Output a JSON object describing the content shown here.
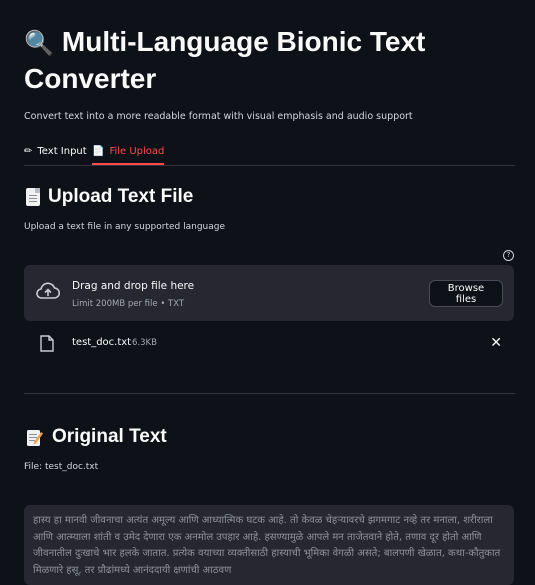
{
  "header": {
    "title_icon": "magnifier-icon",
    "title_glyph": "🔍",
    "title": "Multi-Language Bionic Text Converter",
    "subtitle": "Convert text into a more readable format with visual emphasis and audio support"
  },
  "tabs": [
    {
      "label": "Text Input",
      "icon": "pencil-icon",
      "glyph": "✏",
      "active": false
    },
    {
      "label": "File Upload",
      "icon": "document-icon",
      "glyph": "📄",
      "active": true
    }
  ],
  "upload": {
    "heading": "Upload Text File",
    "caption": "Upload a text file in any supported language",
    "help_glyph": "?",
    "dropzone_title": "Drag and drop file here",
    "dropzone_limit": "Limit 200MB per file • TXT",
    "browse_label": "Browse files",
    "file_name": "test_doc.txt",
    "file_size": "6.3KB",
    "remove_glyph": "✕"
  },
  "original": {
    "heading": "Original Text",
    "file_label": "File: test_doc.txt",
    "text": "हास्य हा मानवी जीवनाचा अत्यंत अमूल्य आणि आध्यात्मिक घटक आहे. तो केवळ चेहऱ्यावरचे झगमगाट नव्हे तर मनाला, शरीराला आणि आत्म्याला शांती व उमेद देणारा एक अनमोल उपहार आहे. हसण्यामुळे आपले मन ताजेतवाने होते, तणाव दूर होतो आणि जीवनातील दुःखाचे भार हलके जातात. प्रत्येक वयाच्या व्यक्तीसाठी हास्याची भूमिका वेगळी असते; बालपणी खेळात, कथा-कौतुकात मिळणारे हसू, तर प्रौढांमध्ये आनंददायी क्षणांची आठवण"
  },
  "colors": {
    "background": "#0e1117",
    "accent": "#ff4b4b",
    "surface": "#262730"
  }
}
